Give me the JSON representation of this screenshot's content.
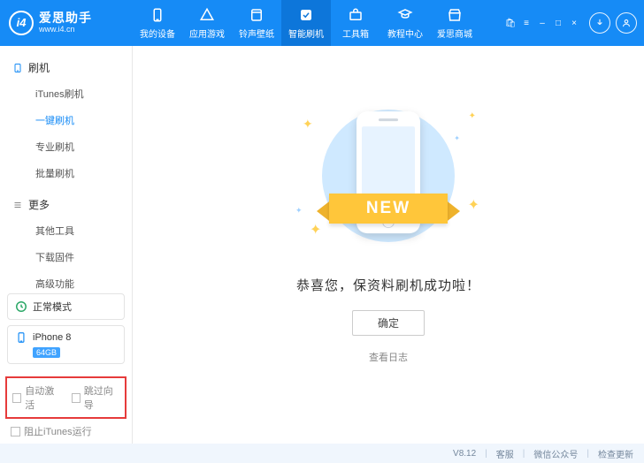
{
  "brand": {
    "name": "爱思助手",
    "url": "www.i4.cn"
  },
  "topTabs": [
    {
      "label": "我的设备"
    },
    {
      "label": "应用游戏"
    },
    {
      "label": "铃声壁纸"
    },
    {
      "label": "智能刷机"
    },
    {
      "label": "工具箱"
    },
    {
      "label": "教程中心"
    },
    {
      "label": "爱思商城"
    }
  ],
  "sidebar": {
    "group1": {
      "title": "刷机",
      "items": [
        "iTunes刷机",
        "一键刷机",
        "专业刷机",
        "批量刷机"
      ]
    },
    "group2": {
      "title": "更多",
      "items": [
        "其他工具",
        "下载固件",
        "高级功能"
      ]
    }
  },
  "status": {
    "mode": "正常模式",
    "device": "iPhone 8",
    "storage": "64GB"
  },
  "bottomChecks": {
    "autoActivate": "自动激活",
    "skipGuide": "跳过向导"
  },
  "preventItunes": "阻止iTunes运行",
  "main": {
    "ribbon": "NEW",
    "congrats": "恭喜您，保资料刷机成功啦！",
    "ok": "确定",
    "viewLog": "查看日志"
  },
  "footer": {
    "version": "V8.12",
    "support": "客服",
    "wechat": "微信公众号",
    "update": "检查更新"
  }
}
